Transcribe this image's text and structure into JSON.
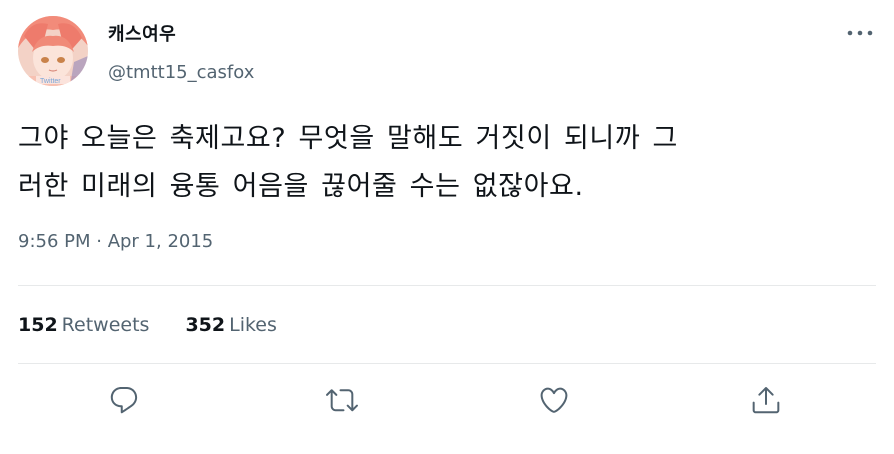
{
  "user": {
    "display_name": "캐스여우",
    "handle": "@tmtt15_casfox",
    "avatar_icon": "profile-avatar"
  },
  "tweet": {
    "text_lines": [
      "그야 오늘은 축제고요? 무엇을 말해도 거짓이 되니까 그",
      "러한 미래의 융통 어음을 끊어줄 수는 없잖아요."
    ],
    "timestamp": "9:56 PM · Apr 1, 2015"
  },
  "stats": {
    "retweets_count": "152",
    "retweets_label": "Retweets",
    "likes_count": "352",
    "likes_label": "Likes"
  },
  "actions": {
    "reply_icon": "reply-icon",
    "retweet_icon": "retweet-icon",
    "like_icon": "heart-icon",
    "share_icon": "share-icon"
  },
  "colors": {
    "text_primary": "#0f1419",
    "text_secondary": "#536471",
    "divider": "#e7e9ea"
  }
}
